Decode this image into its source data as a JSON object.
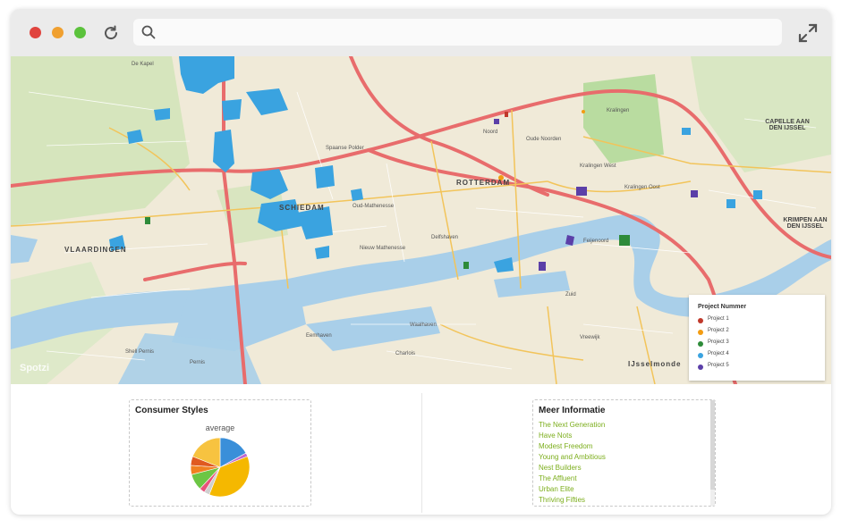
{
  "browser": {
    "traffic_lights": [
      "#e0443e",
      "#f0a030",
      "#5bc23c"
    ],
    "icons": [
      "reload-icon",
      "search-icon",
      "expand-icon"
    ]
  },
  "map": {
    "labels": {
      "de_kapel": "De Kapel",
      "vlaardingen": "VLAARDINGEN",
      "schiedam": "SCHIEDAM",
      "rotterdam": "ROTTERDAM",
      "kralingen": "Kralingen",
      "capelle": "CAPELLE AAN DEN IJSSEL",
      "krimpen": "KRIMPEN AAN DEN IJSSEL",
      "spaanse_polder": "Spaanse Polder",
      "oud_mathenesse": "Oud-Mathenesse",
      "nieuw_mathenesse": "Nieuw Mathenesse",
      "noord": "Noord",
      "oud_noorden": "Oude Noorden",
      "delfshaven": "Delfshaven",
      "kralingen_west": "Kralingen West",
      "kralingen_oost": "Kralingen Oost",
      "feijenoord": "Feijenoord",
      "charlois": "Charlois",
      "waalhaven": "Waalhaven",
      "eemhaven": "Eemhaven",
      "pernis": "Pernis",
      "shell_pernis": "Shell Pernis",
      "zuid": "Zuid",
      "vreewijk": "Vreewijk",
      "ijsselmonde": "IJsselmonde"
    },
    "watermark": "Spotzi"
  },
  "legend": {
    "title": "Project Nummer",
    "items": [
      {
        "label": "Project 1",
        "color": "#c0392b"
      },
      {
        "label": "Project 2",
        "color": "#f39c12"
      },
      {
        "label": "Project 3",
        "color": "#2e8b3a"
      },
      {
        "label": "Project 4",
        "color": "#3aa3e0"
      },
      {
        "label": "Project 5",
        "color": "#5b3fa8"
      }
    ]
  },
  "consumer_styles": {
    "title": "Consumer Styles",
    "subtitle": "average"
  },
  "chart_data": {
    "type": "pie",
    "title": "Consumer Styles",
    "subtitle": "average",
    "slices": [
      {
        "value": 17,
        "color": "#3a8fd9"
      },
      {
        "value": 2,
        "color": "#c06ad0"
      },
      {
        "value": 37,
        "color": "#f5b800"
      },
      {
        "value": 3,
        "color": "#cfcfcf"
      },
      {
        "value": 3,
        "color": "#e8527a"
      },
      {
        "value": 9,
        "color": "#6cc644"
      },
      {
        "value": 5,
        "color": "#f08020"
      },
      {
        "value": 5,
        "color": "#e05a20"
      },
      {
        "value": 19,
        "color": "#f7c340"
      }
    ]
  },
  "meer_informatie": {
    "title": "Meer Informatie",
    "items": [
      "The Next Generation",
      "Have Nots",
      "Modest Freedom",
      "Young and Ambitious",
      "Nest Builders",
      "The Affluent",
      "Urban Elite",
      "Thriving Fifties"
    ]
  }
}
